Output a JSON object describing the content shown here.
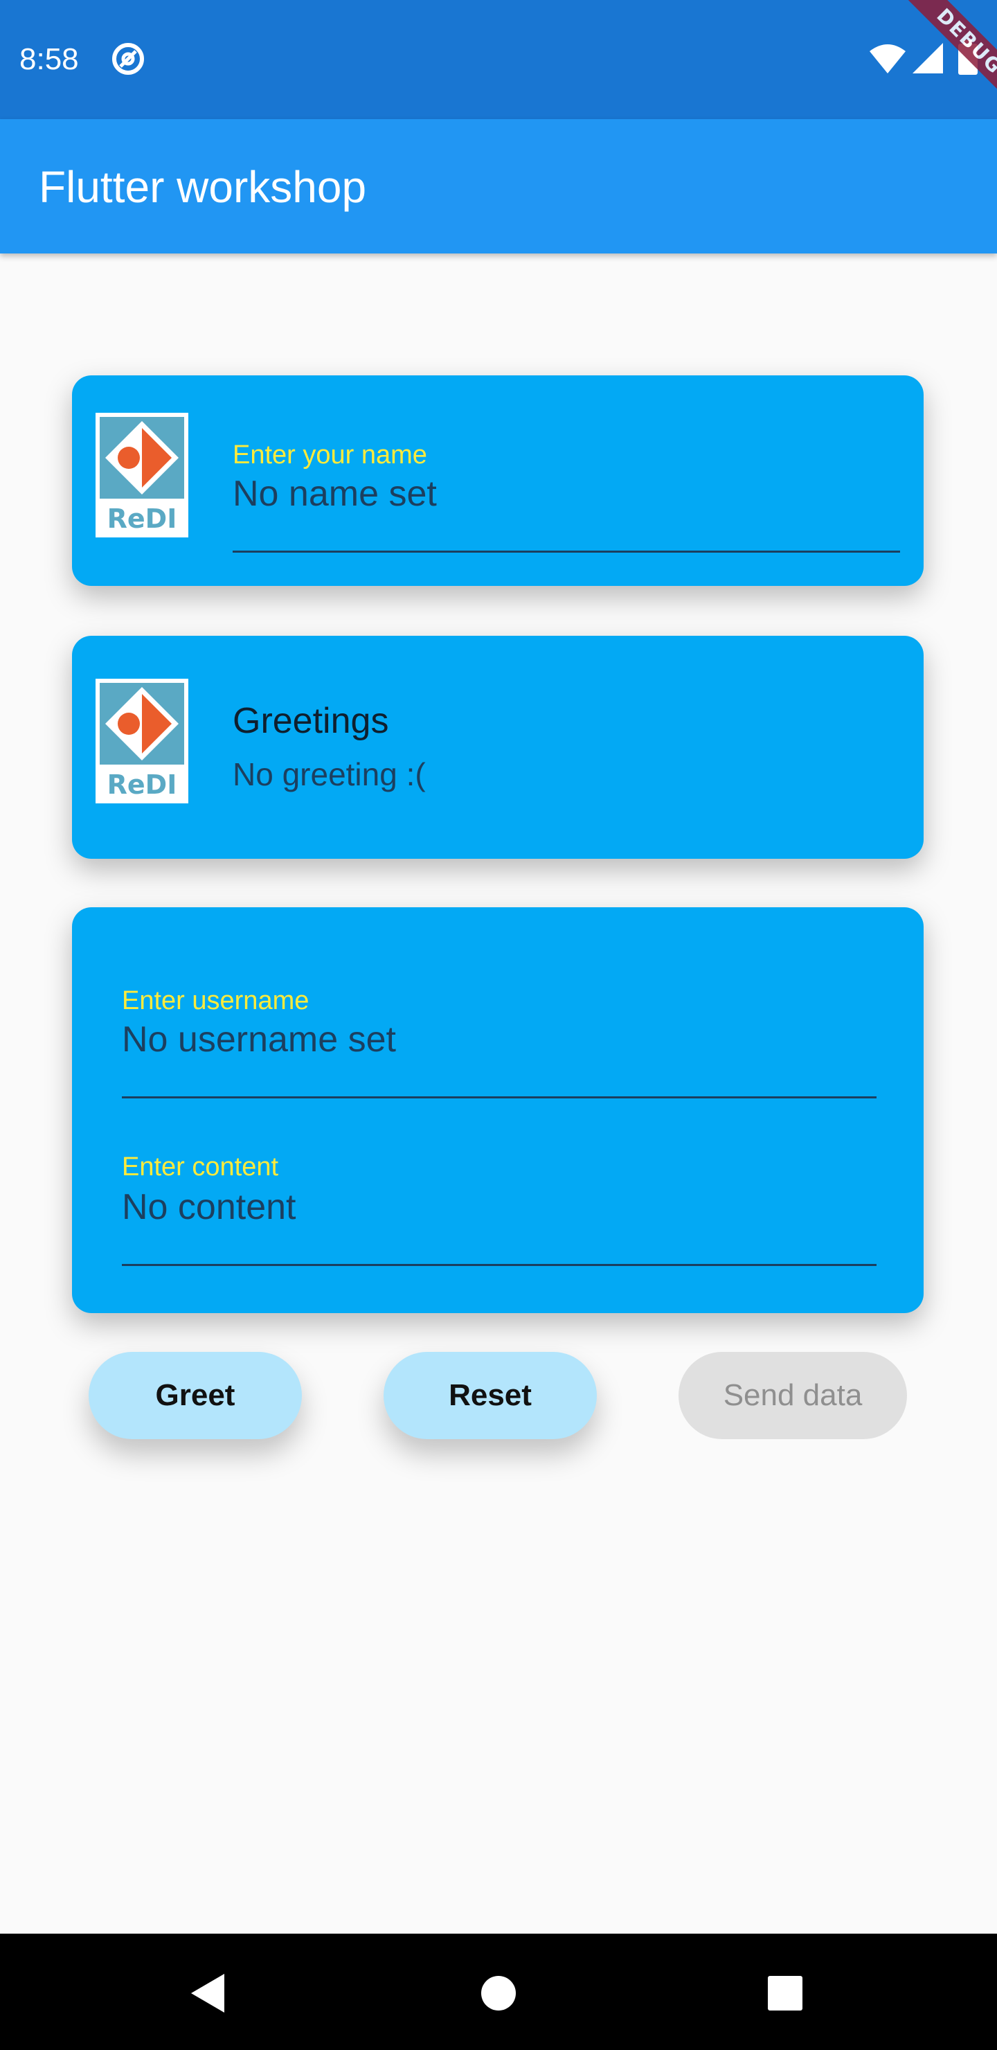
{
  "status_bar": {
    "time": "8:58",
    "debug_label": "DEBUG",
    "icons": [
      "app-notification-icon",
      "wifi-icon",
      "signal-icon",
      "battery-icon"
    ]
  },
  "app_bar": {
    "title": "Flutter workshop",
    "color": "#2196f3"
  },
  "name_card": {
    "logo_text": "ReDI",
    "label": "Enter your name",
    "value": "No name set"
  },
  "greeting_card": {
    "logo_text": "ReDI",
    "title": "Greetings",
    "subtitle": "No greeting :("
  },
  "form_card": {
    "username_label": "Enter username",
    "username_value": "No username set",
    "content_label": "Enter content",
    "content_value": "No content"
  },
  "buttons": {
    "greet": "Greet",
    "reset": "Reset",
    "send": "Send data"
  },
  "nav_bar": {
    "icons": [
      "back-icon",
      "home-icon",
      "recents-icon"
    ]
  },
  "colors": {
    "card": "#03a9f4",
    "label": "#ffeb3b",
    "button": "#b3e5fc",
    "button_disabled": "#e0e0e0"
  }
}
